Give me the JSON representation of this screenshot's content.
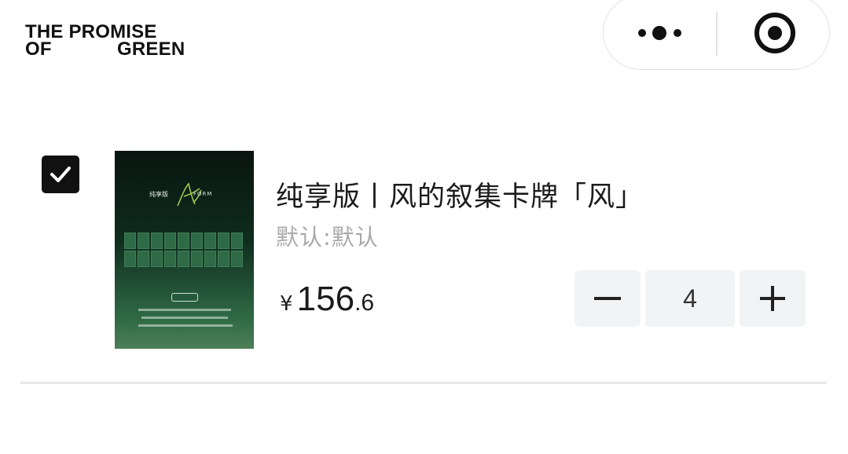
{
  "header": {
    "logo_line1": "THE PROMISE",
    "logo_line2a": "OF",
    "logo_line2b": "GREEN",
    "more_icon": "more-dots-icon",
    "close_icon": "miniprogram-close-icon"
  },
  "cart_item": {
    "checked": true,
    "thumbnail": {
      "tag_left": "纯享版",
      "tag_right": "FORM"
    },
    "title": "纯享版丨风的叙集卡牌「风」",
    "spec": "默认:默认",
    "price_currency": "¥",
    "price_integer": "156",
    "price_decimal": ".6",
    "quantity": "4"
  },
  "colors": {
    "primary_text": "#1b1b1b",
    "secondary_text": "#a9a9a9",
    "stepper_bg": "#f2f3f5",
    "checkbox_bg": "#111111"
  }
}
